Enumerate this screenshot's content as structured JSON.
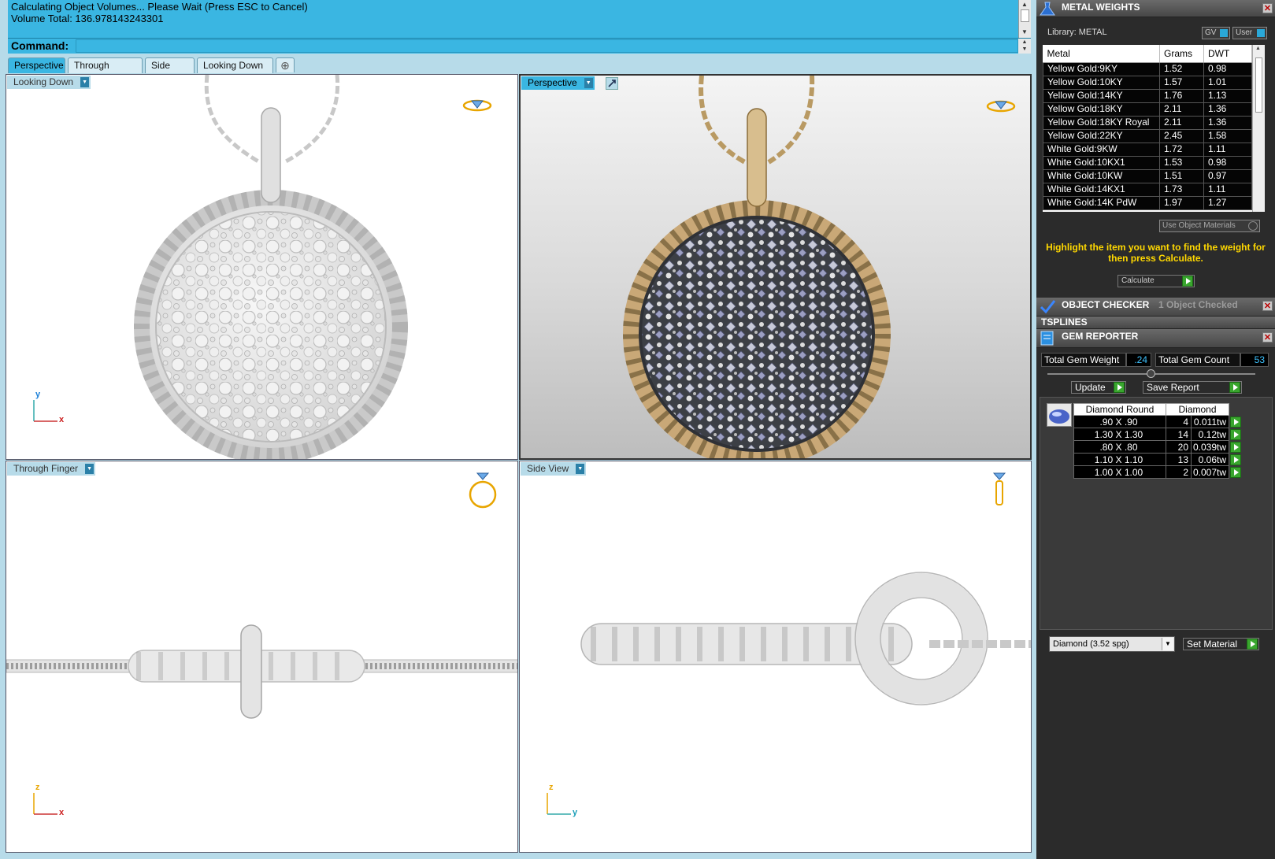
{
  "command": {
    "history": [
      "Calculating Object Volumes... Please Wait (Press ESC to Cancel)",
      "Volume Total: 136.978143243301"
    ],
    "prompt_label": "Command:",
    "input_value": ""
  },
  "tabs": [
    {
      "label": "Perspective",
      "active": true
    },
    {
      "label": "Through Finger",
      "active": false
    },
    {
      "label": "Side View",
      "active": false
    },
    {
      "label": "Looking Down",
      "active": false
    }
  ],
  "viewports": {
    "top_left": {
      "label": "Looking Down",
      "axis_h": "x",
      "axis_v": "y"
    },
    "top_right": {
      "label": "Perspective"
    },
    "bottom_left": {
      "label": "Through Finger",
      "axis_h": "x",
      "axis_v": "z"
    },
    "bottom_right": {
      "label": "Side View",
      "axis_h": "y",
      "axis_v": "z"
    }
  },
  "metal_weights": {
    "title": "METAL WEIGHTS",
    "library": "Library: METAL",
    "gv_label": "GV",
    "user_label": "User",
    "columns": [
      "Metal",
      "Grams",
      "DWT"
    ],
    "rows": [
      [
        "Yellow Gold:9KY",
        "1.52",
        "0.98"
      ],
      [
        "Yellow Gold:10KY",
        "1.57",
        "1.01"
      ],
      [
        "Yellow Gold:14KY",
        "1.76",
        "1.13"
      ],
      [
        "Yellow Gold:18KY",
        "2.11",
        "1.36"
      ],
      [
        "Yellow Gold:18KY Royal",
        "2.11",
        "1.36"
      ],
      [
        "Yellow Gold:22KY",
        "2.45",
        "1.58"
      ],
      [
        "White Gold:9KW",
        "1.72",
        "1.11"
      ],
      [
        "White Gold:10KX1",
        "1.53",
        "0.98"
      ],
      [
        "White Gold:10KW",
        "1.51",
        "0.97"
      ],
      [
        "White Gold:14KX1",
        "1.73",
        "1.11"
      ],
      [
        "White Gold:14K PdW",
        "1.97",
        "1.27"
      ]
    ],
    "use_object_materials": "Use Object Materials",
    "instruction": "Highlight the item you want to find the weight for then press Calculate.",
    "calculate_label": "Calculate"
  },
  "object_checker": {
    "title": "OBJECT CHECKER",
    "status": "1 Object Checked"
  },
  "tsplines": {
    "title": "TSPLINES"
  },
  "gem_reporter": {
    "title": "GEM REPORTER",
    "total_weight_label": "Total Gem Weight",
    "total_weight_value": ".24",
    "total_count_label": "Total Gem Count",
    "total_count_value": "53",
    "update_label": "Update",
    "save_report_label": "Save Report",
    "gem_columns": [
      "Diamond Round",
      "Diamond"
    ],
    "gems": [
      [
        ".90 X .90",
        "4",
        "0.011tw"
      ],
      [
        "1.30 X 1.30",
        "14",
        "0.12tw"
      ],
      [
        ".80 X .80",
        "20",
        "0.039tw"
      ],
      [
        "1.10 X 1.10",
        "13",
        "0.06tw"
      ],
      [
        "1.00 X 1.00",
        "2",
        "0.007tw"
      ]
    ],
    "material_select": "Diamond     (3.52 spg)",
    "set_material_label": "Set Material"
  },
  "colors": {
    "accent": "#3ab6e2",
    "panel_bg": "#2b2b2b",
    "instruction": "#ffd800",
    "metal_gold": "#c9a877"
  }
}
